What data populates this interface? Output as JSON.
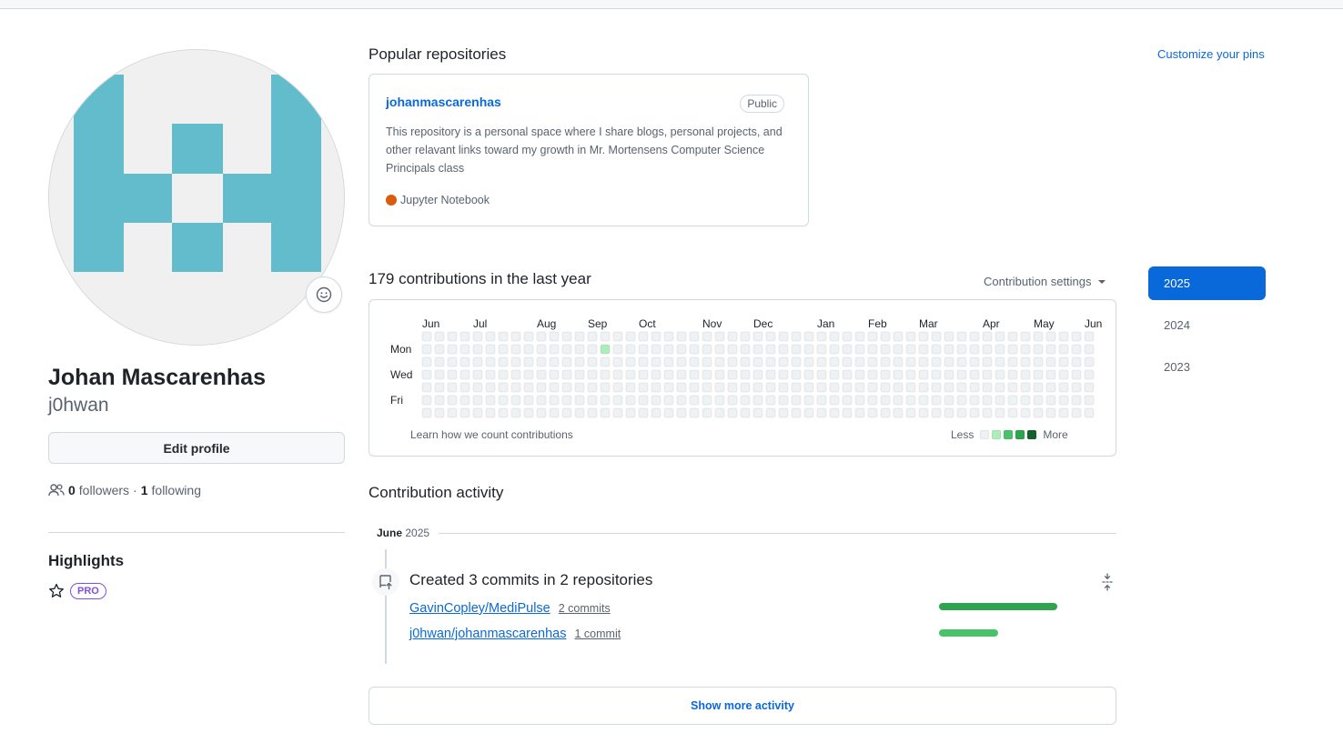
{
  "profile": {
    "name": "Johan Mascarenhas",
    "login": "j0hwan",
    "edit_label": "Edit profile",
    "followers_count": "0",
    "followers_label": "followers",
    "separator": "·",
    "following_count": "1",
    "following_label": "following",
    "avatar_color": "#62bccb",
    "avatar_bg": "#f0f0f0"
  },
  "highlights": {
    "title": "Highlights",
    "badge": "PRO"
  },
  "pinned": {
    "title": "Popular repositories",
    "customize_label": "Customize your pins",
    "repo": {
      "name": "johanmascarenhas",
      "visibility": "Public",
      "description": "This repository is a personal space where I share blogs, personal projects, and other relavant links toward my growth in Mr. Mortensens Computer Science Principals class",
      "language": "Jupyter Notebook",
      "language_color": "#DA5B0B"
    }
  },
  "contributions": {
    "title": "179 contributions in the last year",
    "settings_label": "Contribution settings",
    "months": [
      "Jun",
      "Jul",
      "Aug",
      "Sep",
      "Oct",
      "Nov",
      "Dec",
      "Jan",
      "Feb",
      "Mar",
      "Apr",
      "May",
      "Jun"
    ],
    "day_labels": [
      "Mon",
      "Wed",
      "Fri"
    ],
    "learn_label": "Learn how we count contributions",
    "less_label": "Less",
    "more_label": "More",
    "level_colors": [
      "#eff2f5",
      "#aceebb",
      "#4ac26b",
      "#2da44e",
      "#116329"
    ],
    "grid": [
      "00000000000000000000000000000000000000000000000000000",
      "00000000000000100000000000000000000000000000000000000",
      "00000000000000000000000000000000000000000000000000000",
      "00000000000000000000000000000000000000000000000000000",
      "00000000000000000000000000000000000000000000000000000",
      "00000000000000000000000000000000000000000000000000000",
      "00000000000000000000000000000000000000000000000000000"
    ]
  },
  "years": [
    "2025",
    "2024",
    "2023"
  ],
  "activity": {
    "title": "Contribution activity",
    "month": "June",
    "year": "2025",
    "commit_summary": "Created 3 commits in 2 repositories",
    "repos": [
      {
        "name": "GavinCopley/MediPulse",
        "commits": "2 commits",
        "share": 1.0,
        "color": "#2da44e"
      },
      {
        "name": "j0hwan/johanmascarenhas",
        "commits": "1 commit",
        "share": 0.5,
        "color": "#4ac26b"
      }
    ],
    "show_more_label": "Show more activity"
  }
}
